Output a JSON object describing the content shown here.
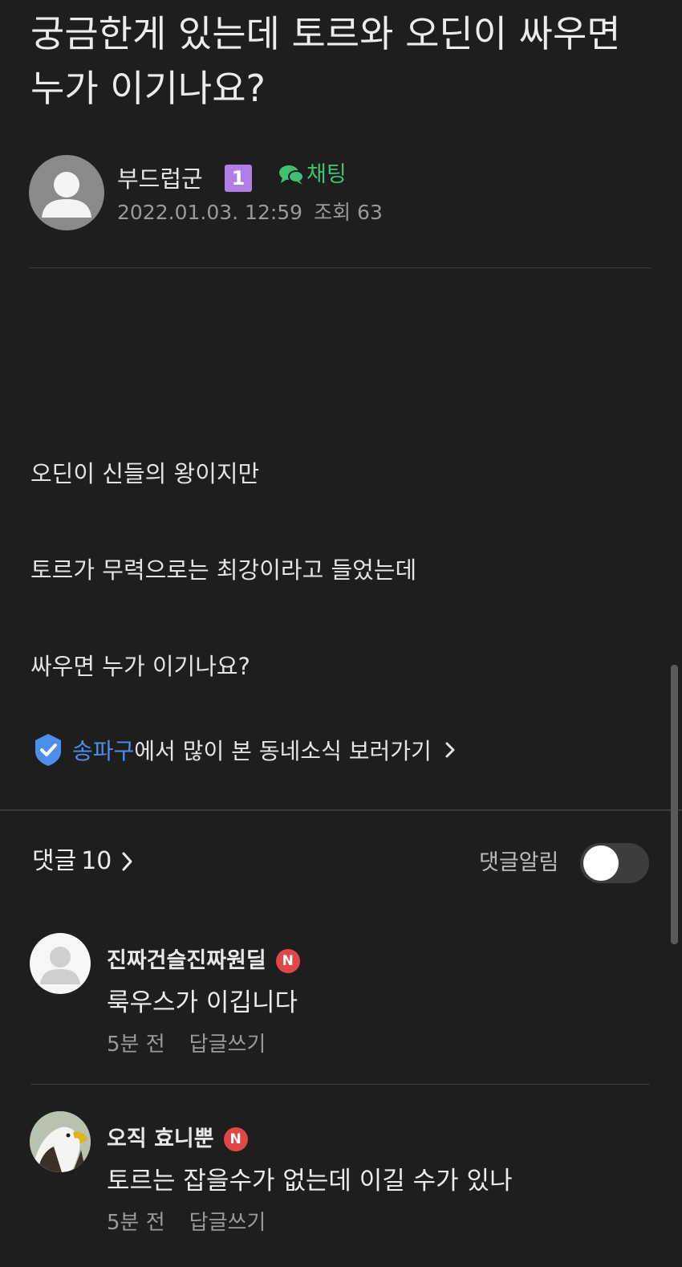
{
  "post": {
    "title": "궁금한게 있는데 토르와 오딘이 싸우면 누가 이기나요?",
    "author": {
      "name": "부드럽군",
      "level": "1",
      "chat_label": "채팅"
    },
    "date": "2022.01.03. 12:59",
    "views": "조회 63",
    "body": [
      "오딘이 신들의 왕이지만",
      "토르가 무력으로는 최강이라고 들었는데",
      "싸우면 누가 이기나요?"
    ],
    "local_news": {
      "district": "송파구",
      "text": "에서 많이 본 동네소식 보러가기"
    }
  },
  "comments_section": {
    "label": "댓글",
    "count": "10",
    "notification_label": "댓글알림",
    "notification_on": false
  },
  "comments": [
    {
      "author": "진짜건슬진짜원딜",
      "badge": "N",
      "text": "룩우스가 이깁니다",
      "time": "5분 전",
      "reply_label": "답글쓰기"
    },
    {
      "author": "오직 효니뿐",
      "badge": "N",
      "text": "토르는 잡을수가 없는데 이길 수가 있나",
      "time": "5분 전",
      "reply_label": "답글쓰기"
    }
  ],
  "colors": {
    "background": "#1e1e1f",
    "chat_green": "#40c070",
    "district_blue": "#4d8eea",
    "level_purple": "#b07ee6",
    "new_badge_red": "#e04848"
  }
}
